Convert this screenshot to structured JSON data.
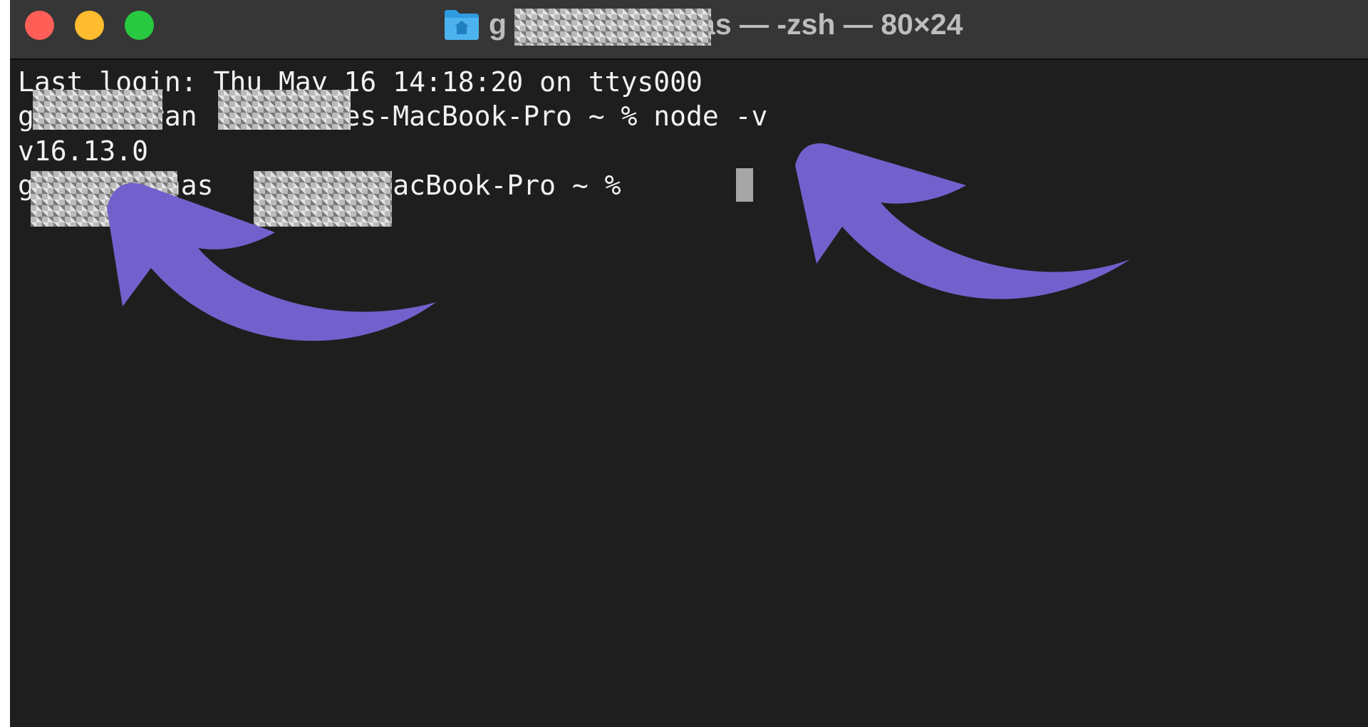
{
  "window": {
    "title_visible_end": "as — -zsh — 80×24",
    "title_visible_start": "g"
  },
  "terminal": {
    "lines": [
      "Last login: Thu May 16 14:18:20 on ttys000",
      "g      aran      ettes-MacBook-Pro ~ % node -v",
      "v16.13.0",
      "g      ranas      tes-MacBook-Pro ~ % "
    ]
  },
  "colors": {
    "terminal_background": "#1e1e1e",
    "titlebar": "#363636",
    "arrow": "#7261cd",
    "close": "#ff5f57",
    "minimize": "#febc2e",
    "maximize": "#28c840"
  },
  "icons": [
    "close-button",
    "minimize-button",
    "maximize-button",
    "folder-home-icon",
    "annotation-arrow"
  ]
}
